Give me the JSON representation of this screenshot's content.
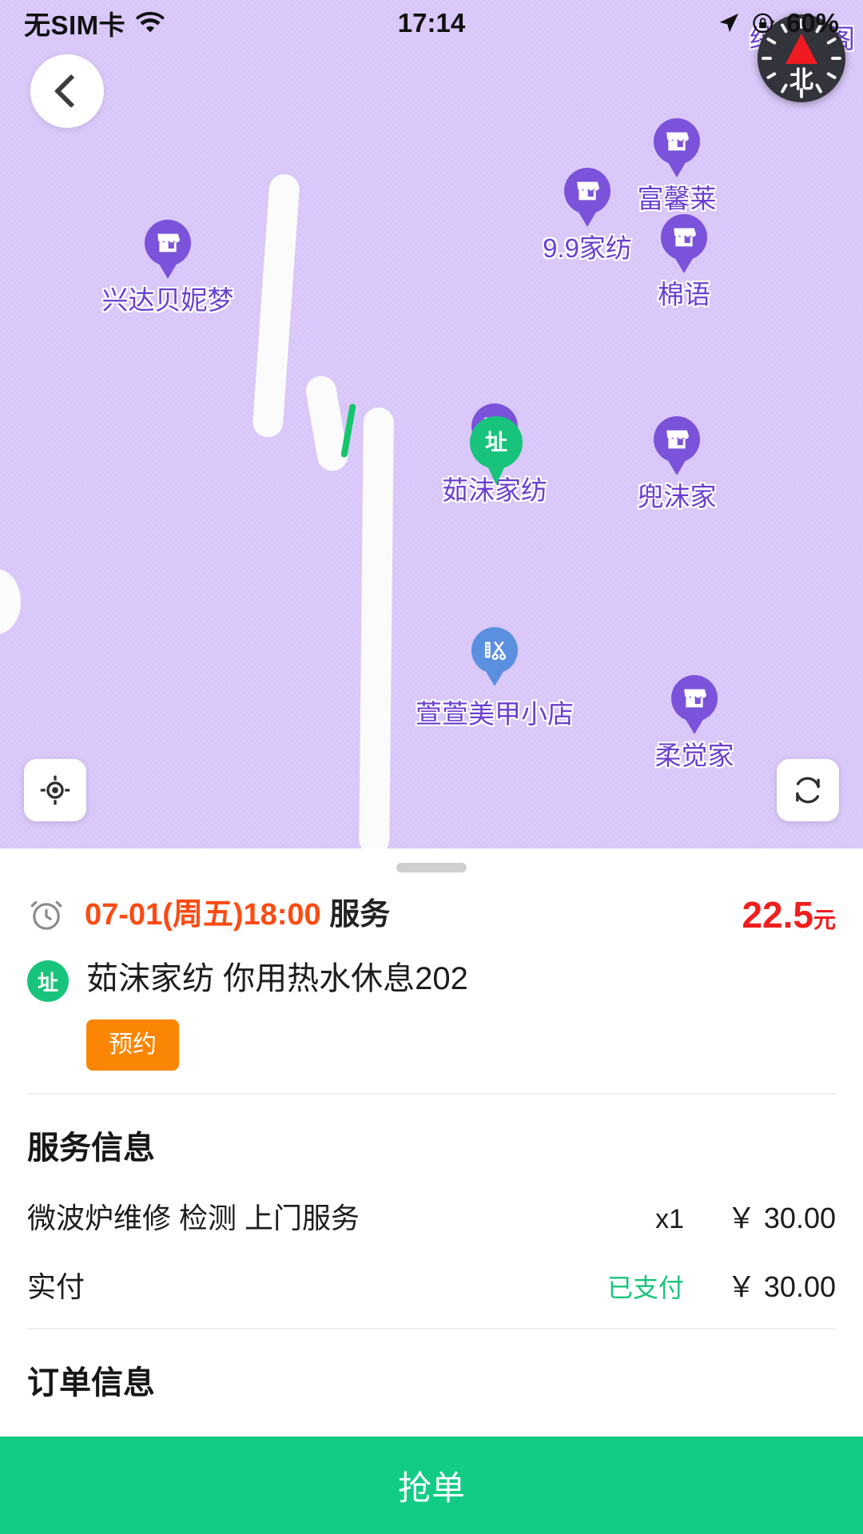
{
  "status_bar": {
    "carrier": "无SIM卡",
    "wifi_icon": "wifi-icon",
    "time": "17:14",
    "location_icon": "location-arrow-icon",
    "lock_icon": "rotation-lock-icon",
    "battery": "60%"
  },
  "map": {
    "back_icon": "back-chevron-icon",
    "compass": {
      "label": "北",
      "name": "compass-north-icon"
    },
    "hidden_label": "绒居一阁",
    "locate_icon": "locate-crosshair-icon",
    "refresh_icon": "refresh-icon",
    "markers": [
      {
        "label": "兴达贝妮梦",
        "icon": "shop-icon",
        "type": "shop"
      },
      {
        "label": "9.9家纺",
        "icon": "shop-icon",
        "type": "shop"
      },
      {
        "label": "富馨莱",
        "icon": "shop-icon",
        "type": "shop"
      },
      {
        "label": "棉语",
        "icon": "shop-icon",
        "type": "shop"
      },
      {
        "label": "茹沫家纺",
        "icon": "shop-icon",
        "type": "shop"
      },
      {
        "label": "兜沫家",
        "icon": "shop-icon",
        "type": "shop"
      },
      {
        "label": "萱萱美甲小店",
        "icon": "salon-scissors-icon",
        "type": "salon"
      },
      {
        "label": "柔觉家",
        "icon": "shop-icon",
        "type": "shop"
      },
      {
        "label": "址",
        "icon": "address-pin-icon",
        "type": "destination"
      }
    ]
  },
  "order": {
    "clock_icon": "alarm-clock-icon",
    "time_label": "07-01(周五)18:00",
    "time_suffix": "服务",
    "price": "22.5",
    "price_unit": "元",
    "address_badge": "址",
    "address": "茹沫家纺 你用热水休息202",
    "booking_tag": "预约"
  },
  "service_info": {
    "title": "服务信息",
    "items": [
      {
        "name": "微波炉维修 检测 上门服务",
        "qty": "x1",
        "amount": "￥ 30.00"
      }
    ],
    "total_label": "实付",
    "paid_flag": "已支付",
    "total_amount": "￥ 30.00"
  },
  "next_section": {
    "title": "订单信息"
  },
  "bottom_action": {
    "label": "抢单"
  },
  "colors": {
    "map_bg": "#dac8fa",
    "marker_purple": "#7b52da",
    "marker_blue": "#5b8fe0",
    "destination_green": "#18c47c",
    "accent_orange": "#fb8605",
    "time_orange": "#fc4b12",
    "price_red": "#f01e1e",
    "action_green": "#12cc86"
  }
}
